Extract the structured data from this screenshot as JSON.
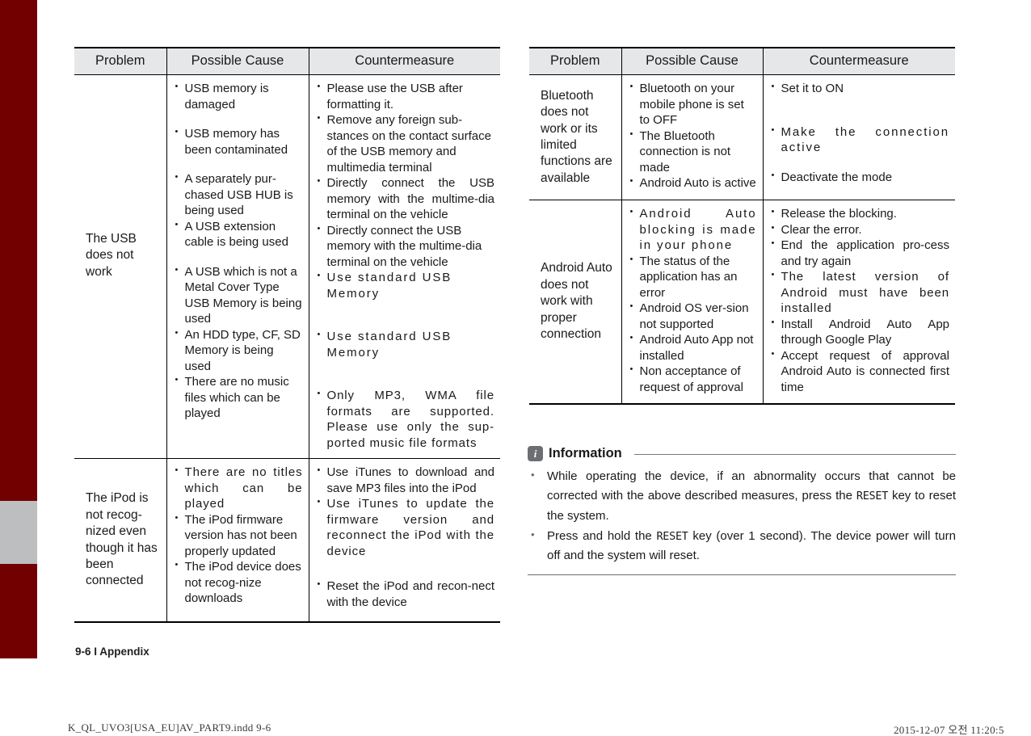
{
  "colors": {
    "spine": "#730000",
    "spine_band": "#bcbec0",
    "header_fill": "#e6e7e8",
    "info_icon": "#6d6e71"
  },
  "tables": {
    "left": {
      "headers": [
        "Problem",
        "Possible Cause",
        "Countermeasure"
      ],
      "rows": [
        {
          "problem": "The USB does not work",
          "causes": [
            "USB memory is damaged",
            "USB memory has been contaminated",
            "A separately pur-chased USB HUB is being used",
            "A USB extension cable is being used",
            "A USB which is not a Metal Cover Type USB Memory is being used",
            "An HDD type, CF, SD Memory is being used",
            "There are no music files which can be played"
          ],
          "countermeasures": [
            "Please use the USB after formatting it.",
            "Remove any foreign sub-stances on the contact surface of the USB memory and multimedia terminal",
            "Directly connect the USB memory with the multime-dia terminal on the vehicle",
            "Directly connect the USB memory with the multime-dia terminal on the vehicle",
            "Use standard USB Memory",
            "Use standard USB Memory",
            "Only MP3, WMA file formats are supported. Please use only the sup-ported music file formats"
          ]
        },
        {
          "problem": "The iPod is not recog-nized even though it has been connected",
          "causes": [
            "There are no titles which can be played",
            "The iPod firmware version has not been properly updated",
            "The iPod device does not recog-nize downloads"
          ],
          "countermeasures": [
            "Use iTunes to download and save MP3 files into the iPod",
            "Use iTunes to update the firmware version and reconnect the iPod with the device",
            "Reset the iPod and recon-nect with the device"
          ]
        }
      ]
    },
    "right": {
      "headers": [
        "Problem",
        "Possible Cause",
        "Countermeasure"
      ],
      "rows": [
        {
          "problem": "Bluetooth does not work or its limited functions are available",
          "causes": [
            "Bluetooth on your mobile phone is set to OFF",
            "The Bluetooth connection is not made",
            "Android Auto is active"
          ],
          "countermeasures": [
            "Set it to ON",
            "Make the connection active",
            "Deactivate the mode"
          ]
        },
        {
          "problem": "Android Auto does not work with proper connection",
          "causes": [
            "Android Auto blocking is made in your phone",
            "The status of the application has an error",
            "Android OS ver-sion not supported",
            "Android Auto App not installed",
            "Non acceptance of request of approval"
          ],
          "countermeasures": [
            "Release the blocking.",
            "Clear the error.",
            "End the application pro-cess and try again",
            "The latest version of Android must have been installed",
            "Install Android Auto App through Google Play",
            "Accept request of approval Android Auto is connected first time"
          ]
        }
      ]
    }
  },
  "information": {
    "title": "Information",
    "icon": "info-icon",
    "items": [
      {
        "part1": "While operating the device, if an abnormality occurs that cannot be corrected with the above described measures, press the ",
        "mono": "RESET",
        "part2": " key to reset the system."
      },
      {
        "part1": "Press and hold the ",
        "mono": "RESET",
        "part2": " key (over 1 second). The device power will turn off and the system will reset."
      }
    ]
  },
  "footer": {
    "page_label": "9-6 I Appendix",
    "print_file": "K_QL_UVO3[USA_EU]AV_PART9.indd   9-6",
    "print_timestamp": "2015-12-07   오전 11:20:5"
  }
}
